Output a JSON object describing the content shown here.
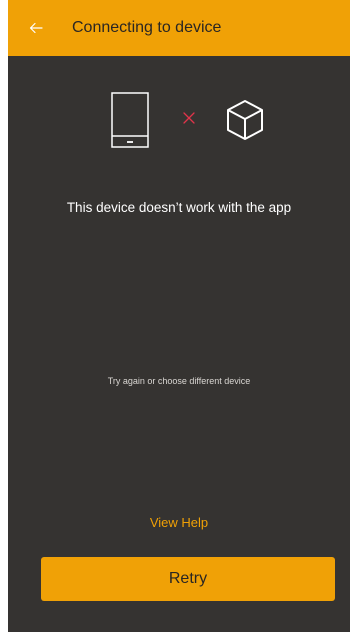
{
  "app_bar": {
    "title": "Connecting to device",
    "back_icon": "arrow-left-icon",
    "color": "#f0a106"
  },
  "illustration": {
    "device_icon": "tablet-icon",
    "status_icon": "cross-icon",
    "target_icon": "cube-icon",
    "status_color": "#e0344a"
  },
  "message": {
    "headline": "This device doesn’t work with the app",
    "hint": "Try again or choose different device"
  },
  "actions": {
    "help_label": "View Help",
    "retry_label": "Retry"
  },
  "colors": {
    "background": "#353331",
    "accent": "#f0a106"
  }
}
